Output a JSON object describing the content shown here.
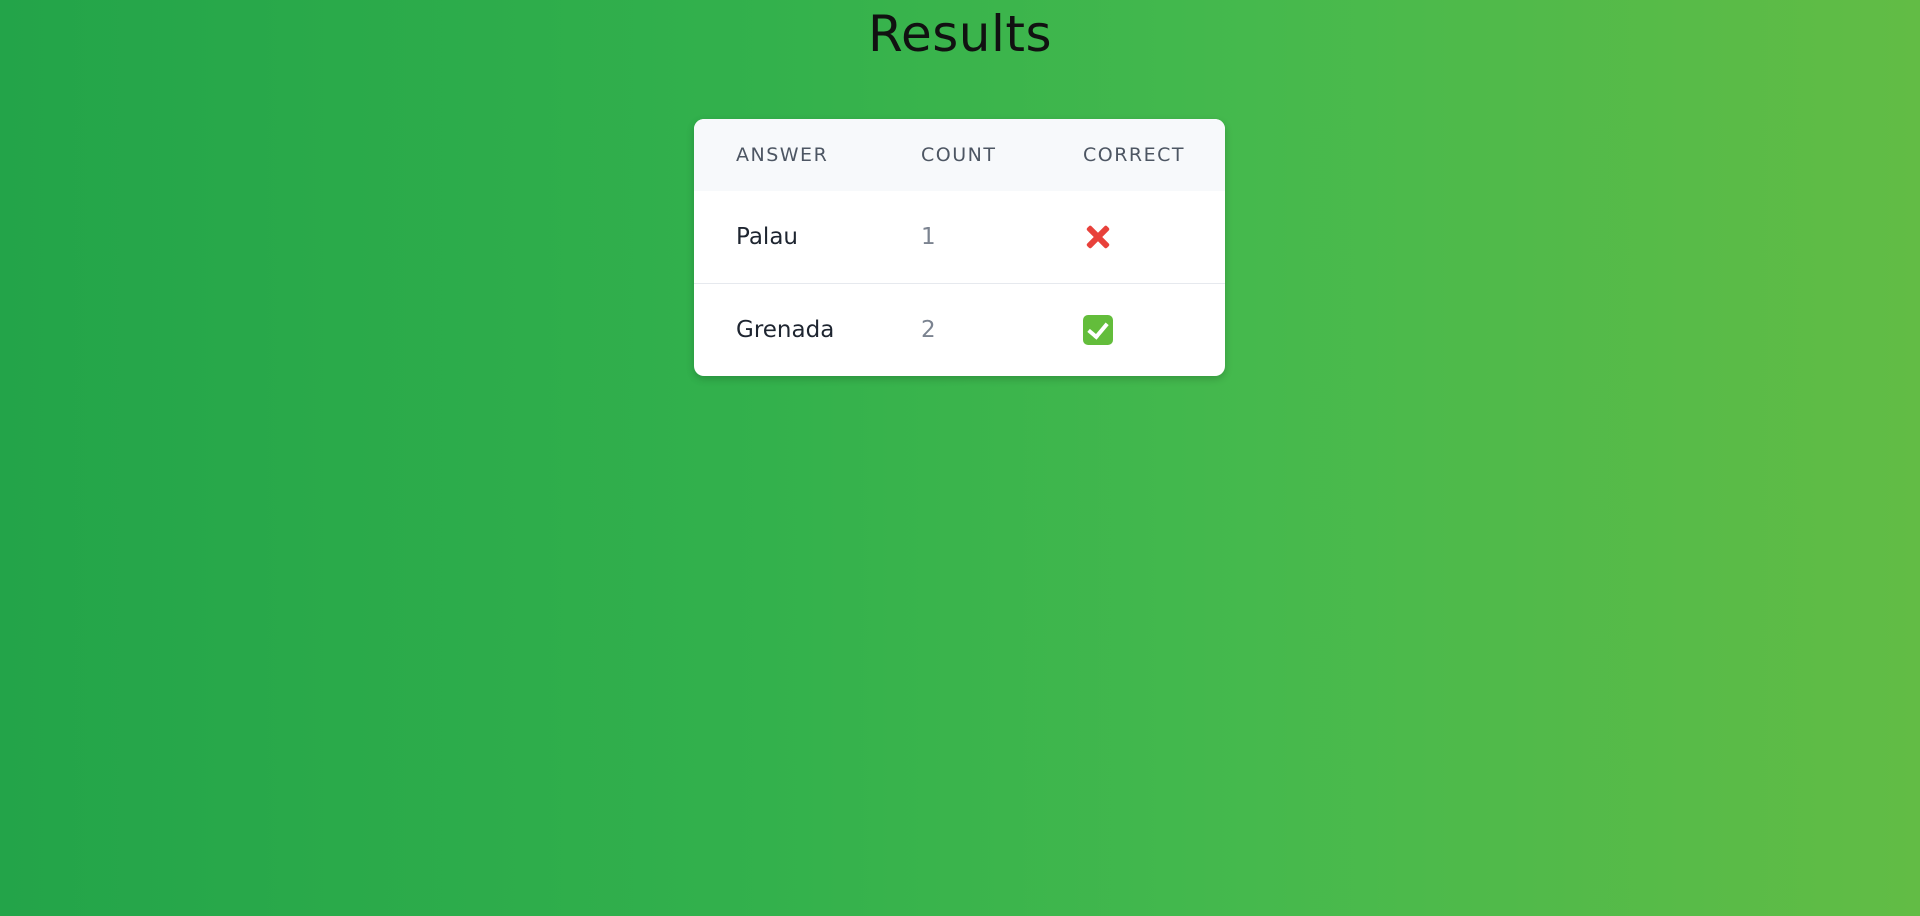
{
  "page": {
    "title": "Results"
  },
  "table": {
    "headers": {
      "answer": "ANSWER",
      "count": "COUNT",
      "correct": "CORRECT"
    },
    "rows": [
      {
        "answer": "Palau",
        "count": "1",
        "correct": false,
        "correct_icon": "cross-mark-icon"
      },
      {
        "answer": "Grenada",
        "count": "2",
        "correct": true,
        "correct_icon": "check-mark-icon"
      }
    ]
  },
  "colors": {
    "gradient_start": "#23a449",
    "gradient_end": "#62bc45",
    "wrong_mark": "#e8413b",
    "correct_mark": "#63bd3b"
  }
}
